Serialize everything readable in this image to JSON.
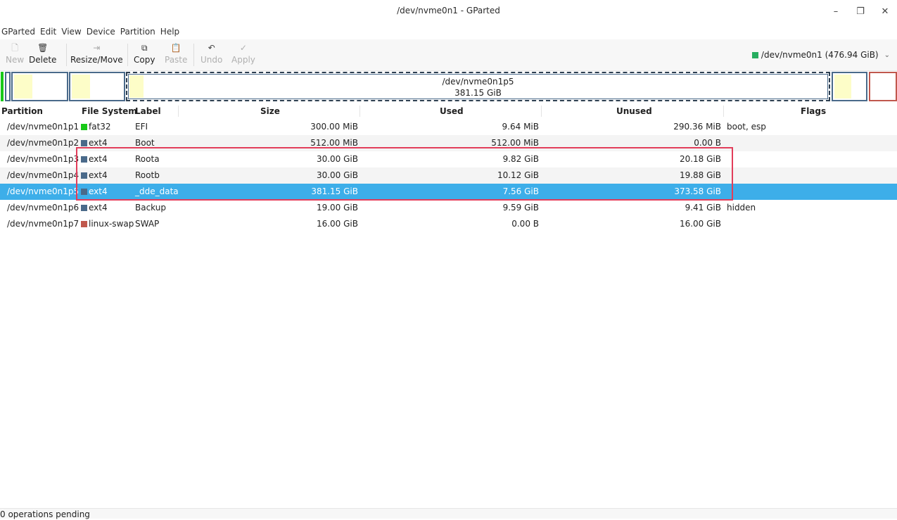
{
  "window": {
    "title": "/dev/nvme0n1 - GParted",
    "minimize_glyph": "–",
    "restore_glyph": "❐",
    "close_glyph": "✕"
  },
  "menu": [
    "GParted",
    "Edit",
    "View",
    "Device",
    "Partition",
    "Help"
  ],
  "toolbar": {
    "buttons": [
      {
        "label": "New",
        "icon": "new-icon",
        "glyph": "🗋",
        "enabled": false
      },
      {
        "label": "Delete",
        "icon": "delete-icon",
        "glyph": "🗑",
        "enabled": true
      },
      {
        "label": "Resize/Move",
        "icon": "resize-move-icon",
        "glyph": "⇥",
        "enabled": true
      },
      {
        "label": "Copy",
        "icon": "copy-icon",
        "glyph": "⧉",
        "enabled": true
      },
      {
        "label": "Paste",
        "icon": "paste-icon",
        "glyph": "📋",
        "enabled": false
      },
      {
        "label": "Undo",
        "icon": "undo-icon",
        "glyph": "↶",
        "enabled": false
      },
      {
        "label": "Apply",
        "icon": "apply-icon",
        "glyph": "✓",
        "enabled": false
      }
    ],
    "device": "/dev/nvme0n1  (476.94 GiB)",
    "device_color": "#27ae60"
  },
  "diskmap": {
    "selected_name": "/dev/nvme0n1p5",
    "selected_size": "381.15 GiB"
  },
  "table": {
    "headers": {
      "partition": "Partition",
      "filesystem": "File System",
      "label": "Label",
      "size": "Size",
      "used": "Used",
      "unused": "Unused",
      "flags": "Flags"
    },
    "rows": [
      {
        "partition": "/dev/nvme0n1p1",
        "fs": "fat32",
        "fs_color": "#18c918",
        "label": "EFI",
        "size": "300.00 MiB",
        "used": "9.64 MiB",
        "unused": "290.36 MiB",
        "flags": "boot, esp"
      },
      {
        "partition": "/dev/nvme0n1p2",
        "fs": "ext4",
        "fs_color": "#4a6a8a",
        "label": "Boot",
        "size": "512.00 MiB",
        "used": "512.00 MiB",
        "unused": "0.00 B",
        "flags": ""
      },
      {
        "partition": "/dev/nvme0n1p3",
        "fs": "ext4",
        "fs_color": "#4a6a8a",
        "label": "Roota",
        "size": "30.00 GiB",
        "used": "9.82 GiB",
        "unused": "20.18 GiB",
        "flags": ""
      },
      {
        "partition": "/dev/nvme0n1p4",
        "fs": "ext4",
        "fs_color": "#4a6a8a",
        "label": "Rootb",
        "size": "30.00 GiB",
        "used": "10.12 GiB",
        "unused": "19.88 GiB",
        "flags": ""
      },
      {
        "partition": "/dev/nvme0n1p5",
        "fs": "ext4",
        "fs_color": "#4a6a8a",
        "label": "_dde_data",
        "size": "381.15 GiB",
        "used": "7.56 GiB",
        "unused": "373.58 GiB",
        "flags": ""
      },
      {
        "partition": "/dev/nvme0n1p6",
        "fs": "ext4",
        "fs_color": "#4a6a8a",
        "label": "Backup",
        "size": "19.00 GiB",
        "used": "9.59 GiB",
        "unused": "9.41 GiB",
        "flags": "hidden"
      },
      {
        "partition": "/dev/nvme0n1p7",
        "fs": "linux-swap",
        "fs_color": "#c0584d",
        "label": "SWAP",
        "size": "16.00 GiB",
        "used": "0.00 B",
        "unused": "16.00 GiB",
        "flags": ""
      }
    ]
  },
  "status": {
    "text": "0 operations pending"
  }
}
